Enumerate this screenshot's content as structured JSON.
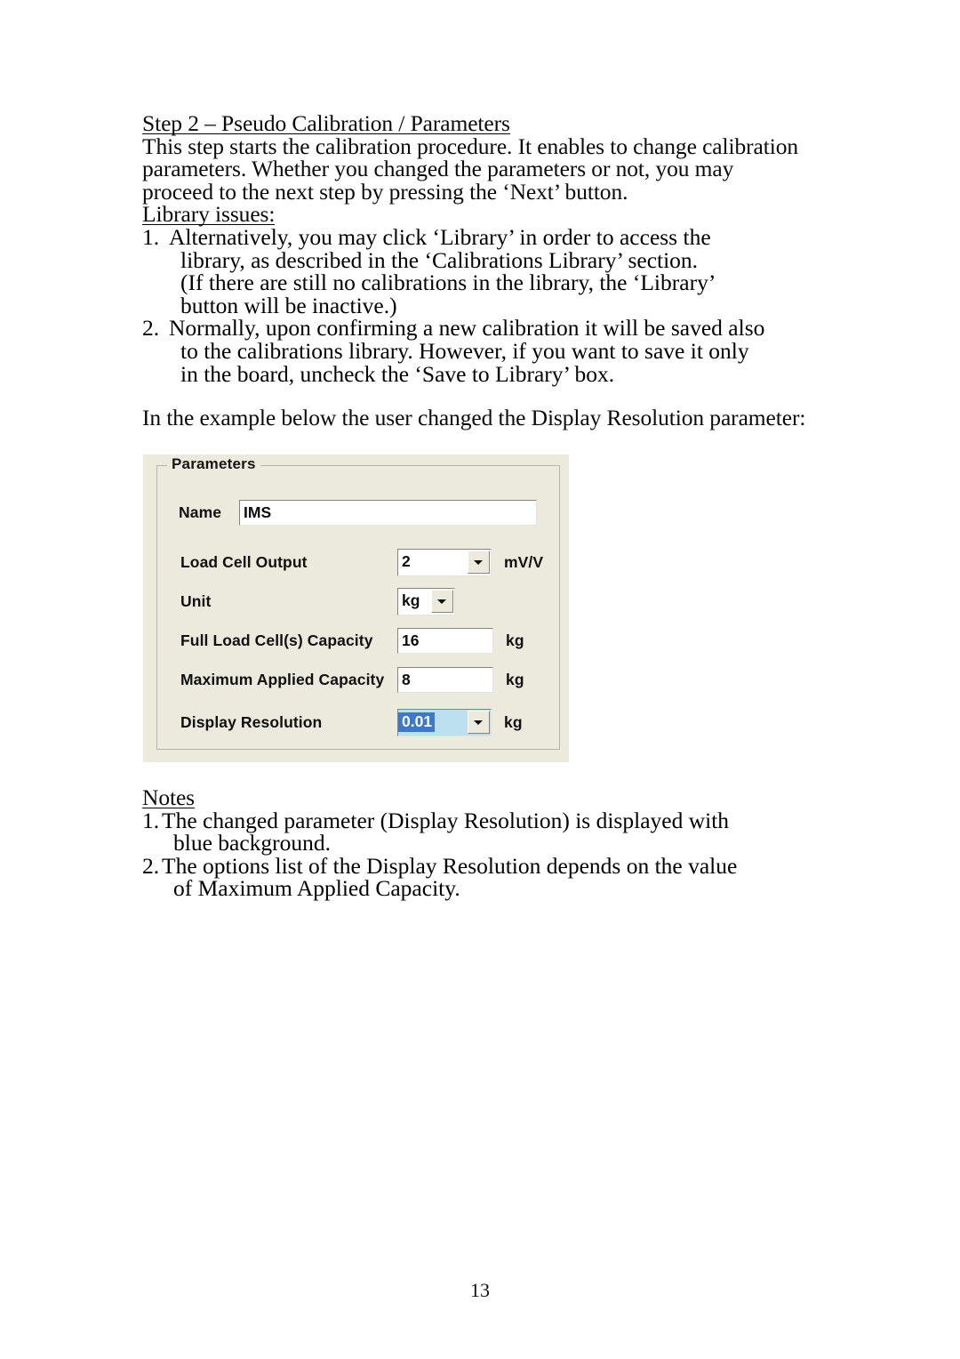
{
  "document": {
    "heading": "Step 2 – Pseudo Calibration / Parameters",
    "intro_lines": [
      "This step starts the calibration procedure. It enables to change calibration",
      "parameters. Whether you changed the parameters or not, you may",
      "proceed to the next step by pressing the ‘Next’ button."
    ],
    "library_heading": "Library issues:",
    "library_items": [
      {
        "number": "1.",
        "lines": [
          "Alternatively, you may click ‘Library’ in order to access the",
          "library, as described in the ‘Calibrations Library’ section.",
          "(If there are still no calibrations in the library, the ‘Library’",
          "button will be inactive.)"
        ]
      },
      {
        "number": "2.",
        "lines": [
          "Normally, upon confirming a new calibration it will be saved also",
          "to the calibrations library. However, if you want to save it only",
          "in the board, uncheck the ‘Save to Library’ box."
        ]
      }
    ],
    "example_caption": "In the example below the user changed the Display Resolution parameter:",
    "notes_heading": "Notes",
    "notes_items": [
      {
        "number": "1.",
        "lines": [
          "The changed parameter (Display Resolution) is displayed with",
          "blue background."
        ]
      },
      {
        "number": "2.",
        "lines": [
          "The options list of the Display Resolution depends on the value",
          "of Maximum Applied Capacity."
        ]
      }
    ],
    "page_number": "13"
  },
  "dialog": {
    "groupbox_title": "Parameters",
    "fields": {
      "name": {
        "label": "Name",
        "value": "IMS"
      },
      "load_cell_output": {
        "label": "Load Cell Output",
        "value": "2",
        "unit": "mV/V",
        "arrow_icon": "chevron-down-icon"
      },
      "unit": {
        "label": "Unit",
        "value": "kg",
        "arrow_icon": "chevron-down-icon"
      },
      "full_load_cells_capacity": {
        "label": "Full Load Cell(s) Capacity",
        "value": "16",
        "unit": "kg"
      },
      "maximum_applied_capacity": {
        "label": "Maximum Applied Capacity",
        "value": "8",
        "unit": "kg"
      },
      "display_resolution": {
        "label": "Display Resolution",
        "value": "0.01",
        "unit": "kg",
        "arrow_icon": "chevron-down-icon"
      }
    },
    "colors": {
      "dialog_background": "#ECE9DD",
      "field_background": "#FFFFFF",
      "changed_field_background": "#BCE0EF",
      "selection_highlight": "#3C78D0",
      "selection_text": "#FFFFFF",
      "border_shadow": "#8A8379"
    }
  }
}
